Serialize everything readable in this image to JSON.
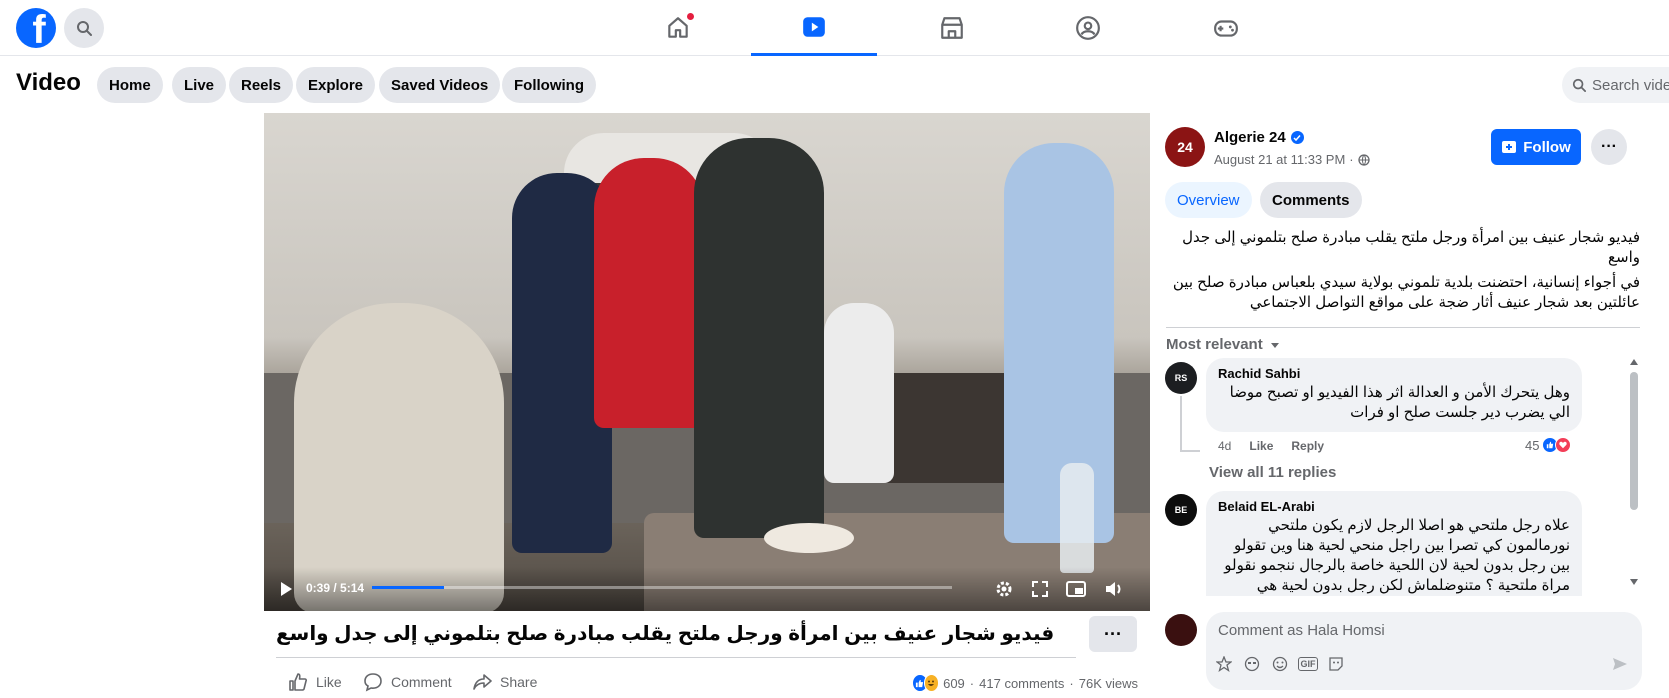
{
  "topnav": {
    "logo_letter": "f",
    "tabs": [
      {
        "name": "home",
        "icon": "home-icon",
        "active": false,
        "has_dot": true
      },
      {
        "name": "video",
        "icon": "video-play-icon",
        "active": true
      },
      {
        "name": "marketplace",
        "icon": "marketplace-icon",
        "active": false
      },
      {
        "name": "groups",
        "icon": "groups-icon",
        "active": false
      },
      {
        "name": "gaming",
        "icon": "gamepad-icon",
        "active": false
      }
    ]
  },
  "subbar": {
    "title": "Video",
    "pills": [
      "Home",
      "Live",
      "Reels",
      "Explore",
      "Saved Videos",
      "Following"
    ],
    "search_placeholder": "Search videos"
  },
  "player": {
    "time": "0:39 / 5:14",
    "progress": 0.124
  },
  "video": {
    "title": "فيديو شجار عنيف بين امرأة ورجل ملتح يقلب مبادرة صلح بتلموني إلى جدل واسع",
    "more": "···",
    "actions": {
      "like": "Like",
      "comment": "Comment",
      "share": "Share"
    },
    "reactions": "609",
    "comments": "417 comments",
    "views": "76K views",
    "separator": "·"
  },
  "side": {
    "channel": {
      "avatar_text": "24",
      "name": "Algerie 24",
      "date": "August 21 at 11:33 PM",
      "date_sep": "·"
    },
    "follow_label": "Follow",
    "more": "···",
    "tabs": {
      "overview": "Overview",
      "comments": "Comments"
    },
    "description": [
      "فيديو شجار عنيف بين امرأة ورجل ملتح يقلب مبادرة صلح بتلموني إلى جدل واسع",
      "في أجواء إنسانية، احتضنت بلدية تلموني بولاية سيدي بلعباس مبادرة صلح بين عائلتين بعد شجار عنيف أثار ضجة على مواقع التواصل الاجتماعي"
    ],
    "sort_label": "Most relevant",
    "comments": [
      {
        "avatar_text": "RS",
        "author": "Rachid Sahbi",
        "text": "وهل يتحرك الأمن و العدالة اثر هذا الفيديو او تصبح موضا الي يضرب دير جلست صلح او فرات",
        "time": "4d",
        "like": "Like",
        "reply": "Reply",
        "reaction_count": "45",
        "view_replies": "View all 11 replies"
      },
      {
        "avatar_text": "BE",
        "author": "Belaid EL-Arabi",
        "text": "علاه رجل ملتحي هو اصلا الرجل لازم يكون ملتحي نورمالمون كي تصرا بين راجل منحي لحية هنا وين تقولو بين رجل بدون لحية لان اللحية خاصة بالرجال ننجمو نقولو مراة ملتحية ؟ متنوضلماش لكن رجل بدون لحية هي"
      }
    ],
    "composer_placeholder": "Comment as Hala Homsi",
    "composer_icons": [
      "sticker-icon",
      "avatar-sticker-icon",
      "emoji-icon",
      "gif-icon",
      "smile-sticker-icon"
    ],
    "gif_label": "GIF"
  },
  "colors": {
    "brand": "#0866ff",
    "notification": "#e41e3f",
    "avatar_channel": "#8b1414"
  }
}
